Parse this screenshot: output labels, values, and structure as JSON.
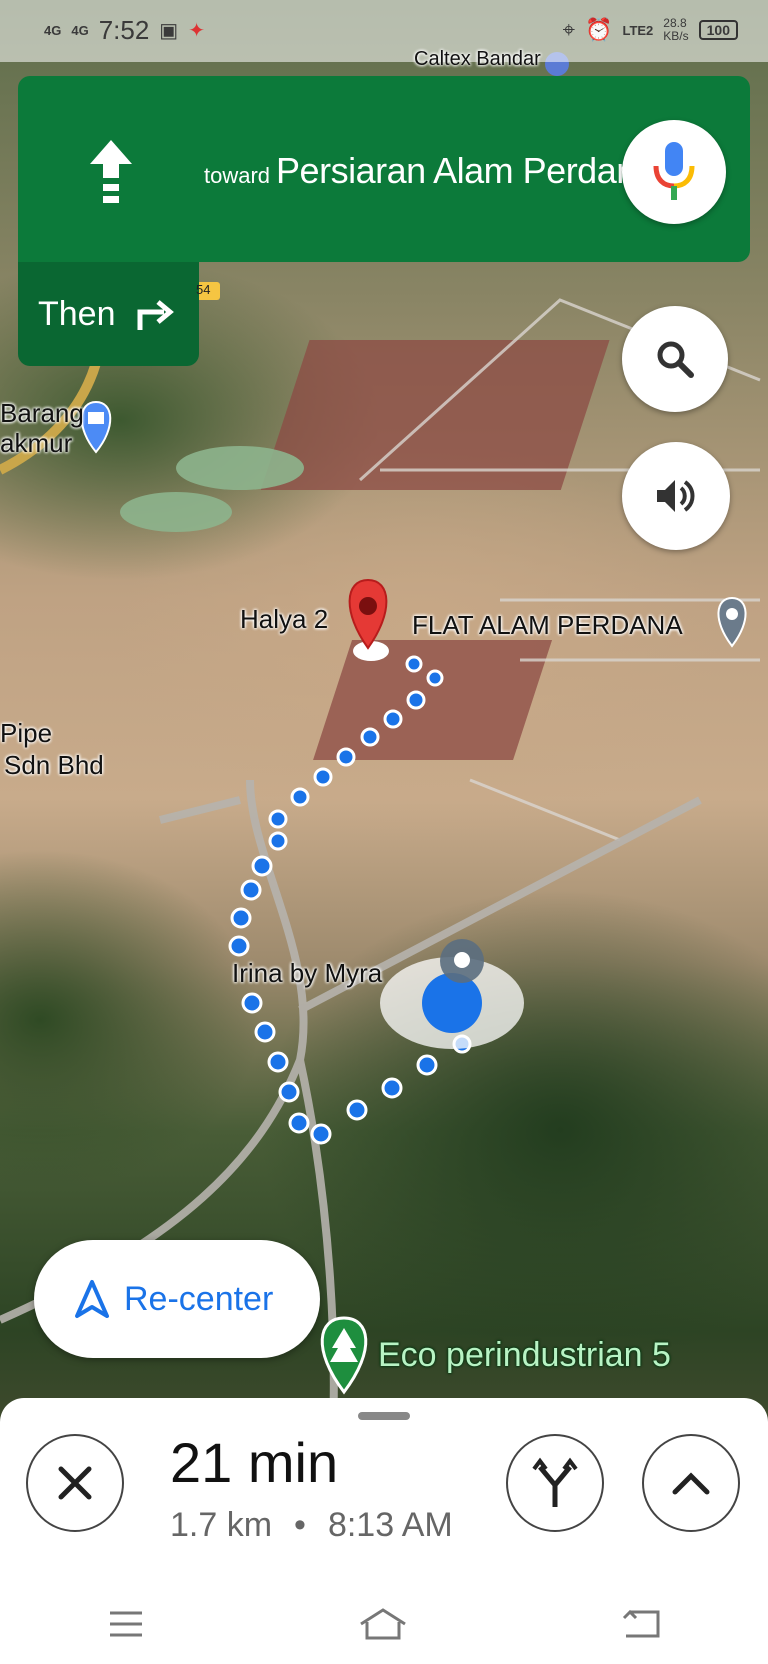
{
  "status_bar": {
    "time": "7:52",
    "signal_1": "4G",
    "signal_2": "4G",
    "network": "LTE2",
    "speed": "28.8",
    "speed_unit": "KB/s",
    "battery": "100"
  },
  "direction": {
    "toward_label": "toward",
    "road": "Persiaran Alam Perdana",
    "then_label": "Then"
  },
  "map_labels": {
    "caltex": "Caltex Bandar",
    "barang": "Barang",
    "makmur": "akmur",
    "halya": "Halya 2",
    "flat": "FLAT ALAM PERDANA",
    "pipe": "Pipe",
    "sdn": "Sdn Bhd",
    "irina": "Irina by Myra",
    "eco": "Eco perindustrian 5",
    "road_num": "54"
  },
  "recenter": {
    "label": "Re-center"
  },
  "trip": {
    "duration": "21 min",
    "distance": "1.7 km",
    "separator": "•",
    "arrival": "8:13 AM"
  },
  "colors": {
    "banner_green": "#0c7a3a",
    "then_green": "#0a6732",
    "route_blue": "#1a73e8",
    "pin_red": "#e53935"
  }
}
